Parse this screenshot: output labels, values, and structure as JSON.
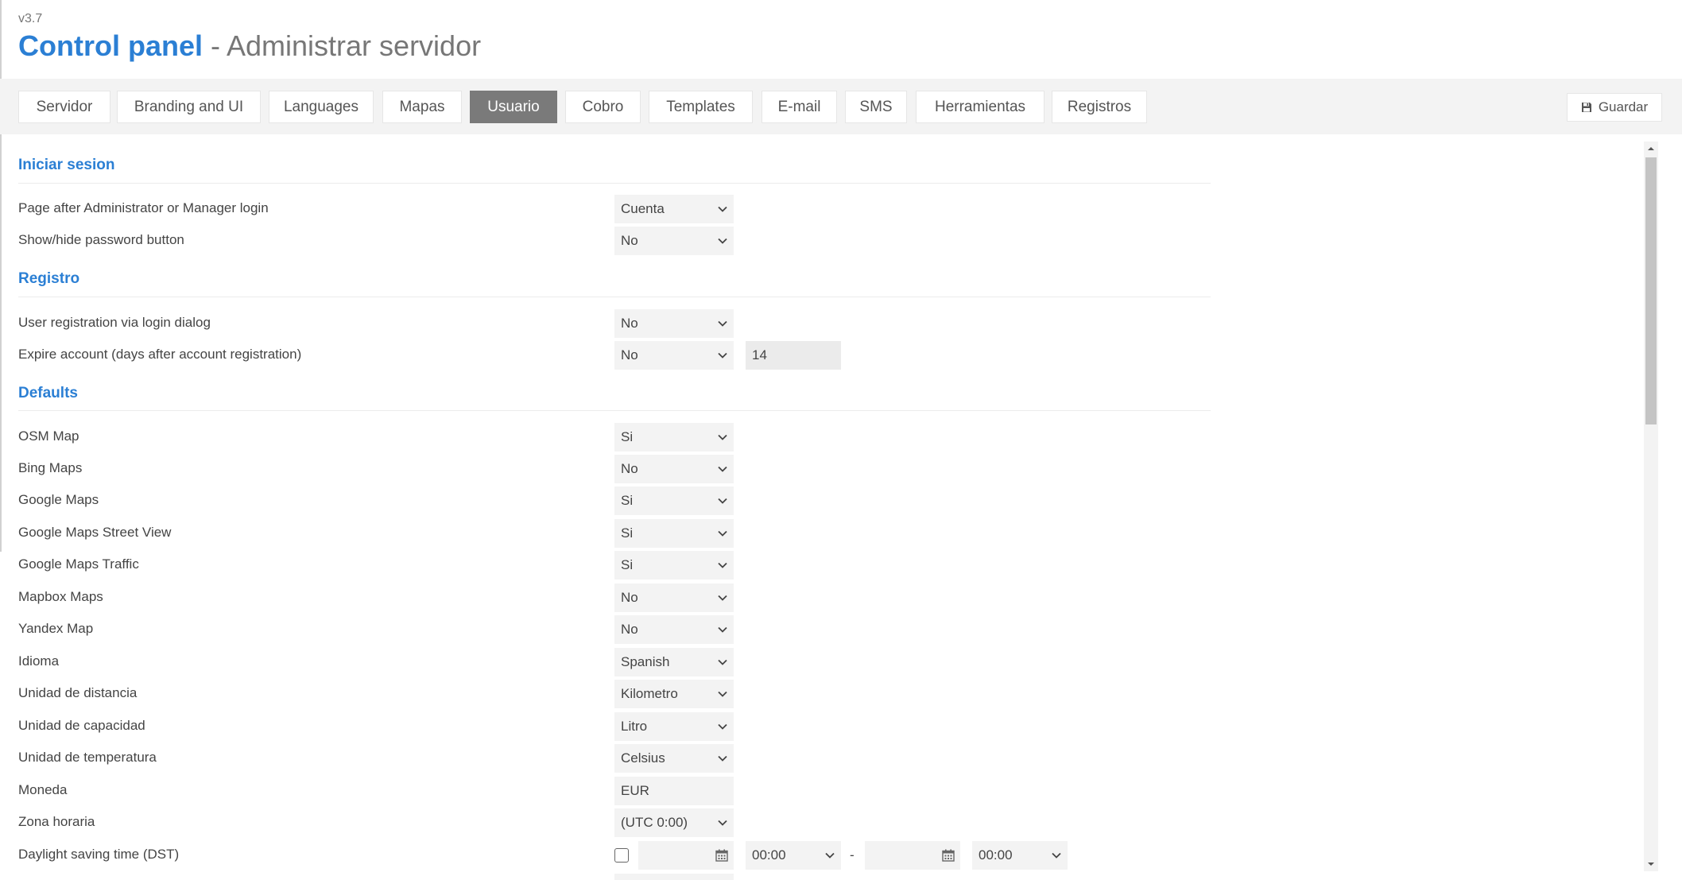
{
  "header": {
    "version": "v3.7",
    "title_main": "Control panel",
    "title_sub": " - Administrar servidor"
  },
  "tabs": [
    {
      "label": "Servidor"
    },
    {
      "label": "Branding and UI"
    },
    {
      "label": "Languages"
    },
    {
      "label": "Mapas"
    },
    {
      "label": "Usuario",
      "active": true
    },
    {
      "label": "Cobro"
    },
    {
      "label": "Templates"
    },
    {
      "label": "E-mail"
    },
    {
      "label": "SMS"
    },
    {
      "label": "Herramientas"
    },
    {
      "label": "Registros"
    }
  ],
  "toolbar": {
    "save_label": "Guardar",
    "save_icon": "floppy-disk-icon"
  },
  "sections": {
    "login": {
      "title": "Iniciar sesion",
      "page_after_login": {
        "label": "Page after Administrator or Manager login",
        "value": "Cuenta"
      },
      "show_hide_password": {
        "label": "Show/hide password button",
        "value": "No"
      }
    },
    "registration": {
      "title": "Registro",
      "user_registration": {
        "label": "User registration via login dialog",
        "value": "No"
      },
      "expire_account": {
        "label": "Expire account (days after account registration)",
        "value": "No",
        "days": "14"
      }
    },
    "defaults": {
      "title": "Defaults",
      "osm_map": {
        "label": "OSM Map",
        "value": "Si"
      },
      "bing_maps": {
        "label": "Bing Maps",
        "value": "No"
      },
      "google_maps": {
        "label": "Google Maps",
        "value": "Si"
      },
      "google_street_view": {
        "label": "Google Maps Street View",
        "value": "Si"
      },
      "google_traffic": {
        "label": "Google Maps Traffic",
        "value": "Si"
      },
      "mapbox_maps": {
        "label": "Mapbox Maps",
        "value": "No"
      },
      "yandex_map": {
        "label": "Yandex Map",
        "value": "No"
      },
      "language": {
        "label": "Idioma",
        "value": "Spanish"
      },
      "distance_unit": {
        "label": "Unidad de distancia",
        "value": "Kilometro"
      },
      "capacity_unit": {
        "label": "Unidad de capacidad",
        "value": "Litro"
      },
      "temperature_unit": {
        "label": "Unidad de temperatura",
        "value": "Celsius"
      },
      "currency": {
        "label": "Moneda",
        "value": "EUR"
      },
      "timezone": {
        "label": "Zona horaria",
        "value": "(UTC 0:00)"
      },
      "dst": {
        "label": "Daylight saving time (DST)",
        "checked": false,
        "start_date": "",
        "start_time": "00:00",
        "separator": "-",
        "end_date": "",
        "end_time": "00:00"
      }
    }
  },
  "colors": {
    "accent": "#2b7fd4",
    "active_tab": "#7a7a7a",
    "field_bg": "#f3f3f3"
  }
}
